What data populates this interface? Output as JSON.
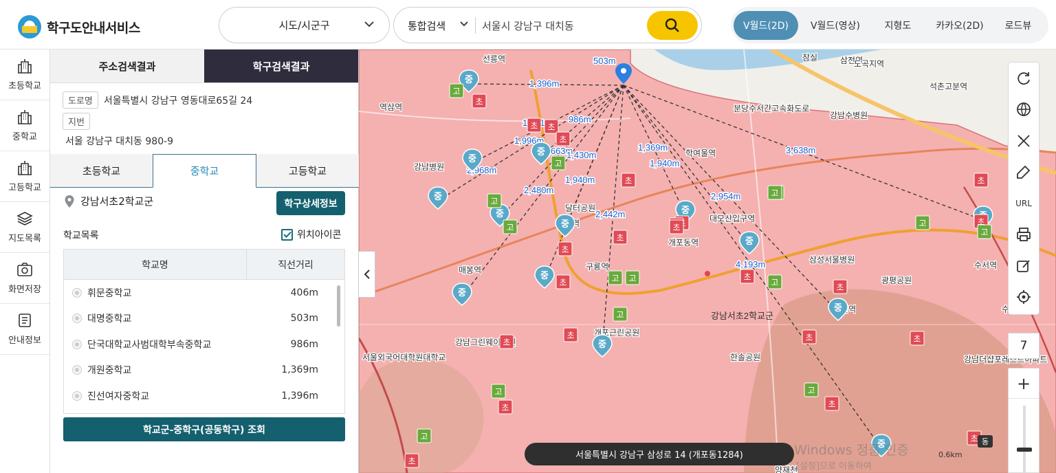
{
  "app": {
    "title": "학구도안내서비스"
  },
  "header": {
    "region_select": "시도/시군구",
    "search_type": "통합검색",
    "search_value": "서울시 강남구 대치동",
    "view_tabs": [
      "V월드(2D)",
      "V월드(영상)",
      "지형도",
      "카카오(2D)",
      "로드뷰"
    ]
  },
  "leftnav": [
    {
      "label": "초등학교",
      "icon": "school-building-icon"
    },
    {
      "label": "중학교",
      "icon": "school-building-icon"
    },
    {
      "label": "고등학교",
      "icon": "school-building-icon"
    },
    {
      "label": "지도목록",
      "icon": "layers-icon"
    },
    {
      "label": "화면저장",
      "icon": "camera-icon"
    },
    {
      "label": "안내정보",
      "icon": "document-icon"
    }
  ],
  "panel": {
    "tabs": [
      "주소검색결과",
      "학구검색결과"
    ],
    "road_tag": "도로명",
    "road_address": "서울특별시 강남구 영동대로65길 24",
    "lot_tag": "지번",
    "lot_address": "서울 강남구 대치동 980-9",
    "level_tabs": [
      "초등학교",
      "중학교",
      "고등학교"
    ],
    "district_name": "강남서초2학교군",
    "detail_button": "학구상세정보",
    "list_title": "학교목록",
    "location_icon_label": "위치아이콘",
    "table_headers": [
      "학교명",
      "직선거리"
    ],
    "schools": [
      {
        "name": "휘문중학교",
        "distance": "406m"
      },
      {
        "name": "대명중학교",
        "distance": "503m"
      },
      {
        "name": "단국대학교사범대학부속중학교",
        "distance": "986m"
      },
      {
        "name": "개원중학교",
        "distance": "1,369m"
      },
      {
        "name": "진선여자중학교",
        "distance": "1,396m"
      }
    ],
    "action_button": "학교군-중학구(공동학구) 조회"
  },
  "map": {
    "status_text": "서울특별시 강남구 삼성로 14 (개포동1284)",
    "zoom_level": "7",
    "scale_label": "0.6km",
    "district_label": "강남서초2학교군",
    "tool_url_label": "URL",
    "east_tag": "동",
    "watermark_line1": "Windows 정품 인증",
    "watermark_line2": "[설정]으로 이동하여",
    "distances": [
      "503m",
      "1,396m",
      "1,541m",
      "986m",
      "1,996m",
      "1,663m",
      "1,430m",
      "1,369m",
      "1,940m",
      "3,638m",
      "2,968m",
      "2,480m",
      "1,940m",
      "2,954m",
      "2,442m",
      "4,193m"
    ],
    "place_labels": [
      "선릉역",
      "잠실",
      "삼전역",
      "석촌고분역",
      "역삼역",
      "강남수병원",
      "분당수서간고속화도로",
      "강남병원",
      "학여울역",
      "대모산입구역",
      "개포동역",
      "삼성서울병원",
      "광평공원",
      "일원역",
      "구룡역",
      "매봉역",
      "도곡역",
      "달터공원",
      "강남그린웨이공원",
      "개포근린공원",
      "한솔공원",
      "강남더샵포레스트아파트",
      "서울외국어대학원대학교",
      "수서역",
      "수서",
      "큰사람",
      "양재천",
      "도곡지역"
    ]
  },
  "colors": {
    "accent": "#14606f",
    "active_view": "#4f8fb4",
    "search_button": "#f7c400",
    "district_fill": "#f4a6a6",
    "middle_marker": "#5aa9c9",
    "elementary_marker": "#e04b55",
    "high_marker": "#6aaa3c"
  }
}
